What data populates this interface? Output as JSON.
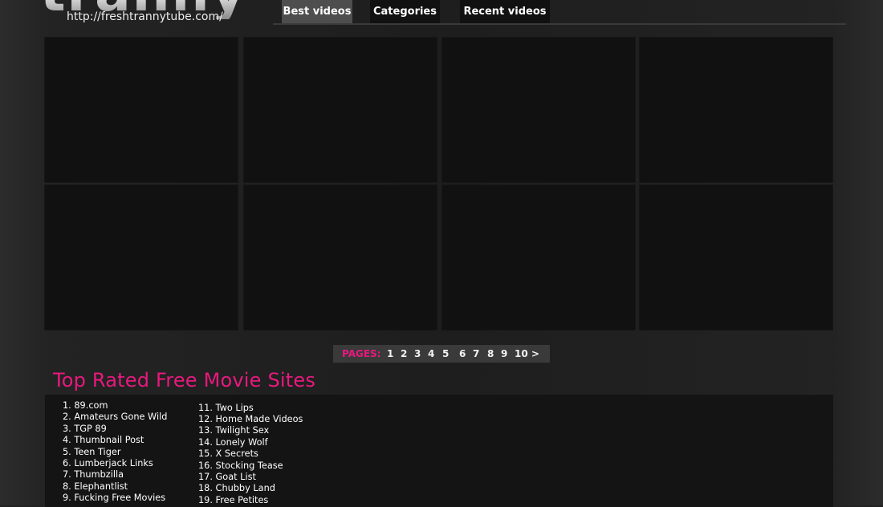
{
  "header": {
    "logo_text": "tranny",
    "logo_url": "http://freshtrannytube.com/"
  },
  "nav": {
    "tabs": [
      {
        "label": "Best videos",
        "active": true
      },
      {
        "label": "Categories",
        "active": false
      },
      {
        "label": "Recent videos",
        "active": false
      }
    ]
  },
  "pagination": {
    "label": "PAGES:",
    "pages": [
      "1",
      "2",
      "3",
      "4",
      "5",
      "6",
      "7",
      "8",
      "9",
      "10 >"
    ]
  },
  "top_rated": {
    "title": "Top Rated Free Movie Sites",
    "column1": [
      "1. 89.com",
      "2. Amateurs Gone Wild",
      "3. TGP 89",
      "4. Thumbnail Post",
      "5. Teen Tiger",
      "6. Lumberjack Links",
      "7. Thumbzilla",
      "8. Elephantlist",
      "9. Fucking Free Movies"
    ],
    "column2": [
      "11. Two Lips",
      "12. Home Made Videos",
      "13. Twilight Sex",
      "14. Lonely Wolf",
      "15. X Secrets",
      "16. Stocking Tease",
      "17. Goat List",
      "18. Chubby Land",
      "19. Free Petites"
    ]
  },
  "colors": {
    "accent": "#e8197e",
    "background": "#222222",
    "thumbnail": "#111111",
    "active_tab": "#4e4e4e"
  }
}
